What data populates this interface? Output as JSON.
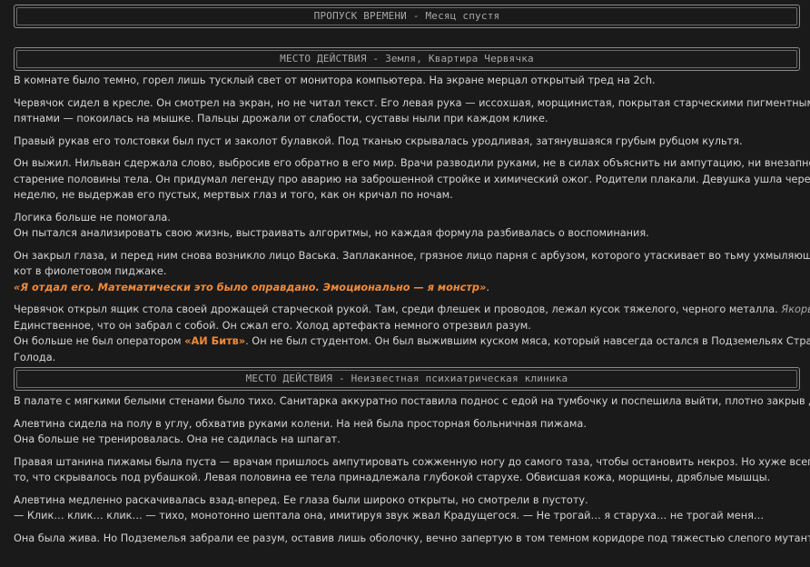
{
  "banners": {
    "time_skip": "ПРОПУСК ВРЕМЕНИ - Месяц спустя",
    "scene1": "МЕСТО ДЕЙСТВИЯ - Земля, Квартира Червячка",
    "scene2": "МЕСТО ДЕЙСТВИЯ - Неизвестная психиатрическая клиника"
  },
  "scene1": {
    "p1": "В комнате было темно, горел лишь тусклый свет от монитора компьютера. На экране мерцал открытый тред на 2ch.",
    "p2_l1": "Червячок сидел в кресле. Он смотрел на экран, но не читал текст. Его левая рука — иссохшая, морщинистая, покрытая старческими пигментными",
    "p2_l2": "пятнами — покоилась на мышке. Пальцы дрожали от слабости, суставы ныли при каждом клике.",
    "p3": "Правый рукав его толстовки был пуст и заколот булавкой. Под тканью скрывалась уродливая, затянувшаяся грубым рубцом культя.",
    "p4_l1": "Он выжил. Нильван сдержала слово, выбросив его обратно в его мир. Врачи разводили руками, не в силах объяснить ни ампутацию, ни внезапное",
    "p4_l2": "старение половины тела. Он придумал легенду про аварию на заброшенной стройке и химический ожог. Родители плакали. Девушка ушла через",
    "p4_l3": "неделю, не выдержав его пустых, мертвых глаз и того, как он кричал по ночам.",
    "p5_l1": "Логика больше не помогала.",
    "p5_l2": "Он пытался анализировать свою жизнь, выстраивать алгоритмы, но каждая формула разбивалась о воспоминания.",
    "p6_l1": "Он закрыл глаза, и перед ним снова возникло лицо Васька. Заплаканное, грязное лицо парня с арбузом, которого утаскивает во тьму ухмыляющийся",
    "p6_l2": "кот в фиолетовом пиджаке.",
    "p6_quote": "«Я отдал его. Математически это было оправдано. Эмоционально — я монстр»",
    "p6_quote_end": ".",
    "p7_l1a": "Червячок открыл ящик стола своей дрожащей старческой рукой. Там, среди флешек и проводов, лежал кусок тяжелого, черного металла. ",
    "p7_anchor": "Якорь души",
    "p7_l1b": ".",
    "p7_l2": "Единственное, что он забрал с собой. Он сжал его. Холод артефакта немного отрезвил разум.",
    "p7_l3a": "Он больше не был оператором ",
    "p7_ai": "«АИ Битв»",
    "p7_l3b": ". Он не был студентом. Он был выжившим куском мяса, который навсегда остался в Подземельях Страха и",
    "p7_l4": "Голода."
  },
  "scene2": {
    "p1": "В палате с мягкими белыми стенами было тихо. Санитарка аккуратно поставила поднос с едой на тумбочку и поспешила выйти, плотно закрыв дверь.",
    "p2_l1": "Алевтина сидела на полу в углу, обхватив руками колени. На ней была просторная больничная пижама.",
    "p2_l2": "Она больше не тренировалась. Она не садилась на шпагат.",
    "p3_l1": "Правая штанина пижамы была пуста — врачам пришлось ампутировать сожженную ногу до самого таза, чтобы остановить некроз. Но хуже всего было",
    "p3_l2": "то, что скрывалось под рубашкой. Левая половина ее тела принадлежала глубокой старухе. Обвисшая кожа, морщины, дряблые мышцы.",
    "p4_l1": "Алевтина медленно раскачивалась взад-вперед. Ее глаза были широко открыты, но смотрели в пустоту.",
    "p4_l2": "— Клик… клик… клик… — тихо, монотонно шептала она, имитируя звук жвал Крадущегося. — Не трогай… я старуха… не трогай меня…",
    "p5": "Она была жива. Но Подземелья забрали ее разум, оставив лишь оболочку, вечно запертую в том темном коридоре под тяжестью слепого мутанта."
  }
}
